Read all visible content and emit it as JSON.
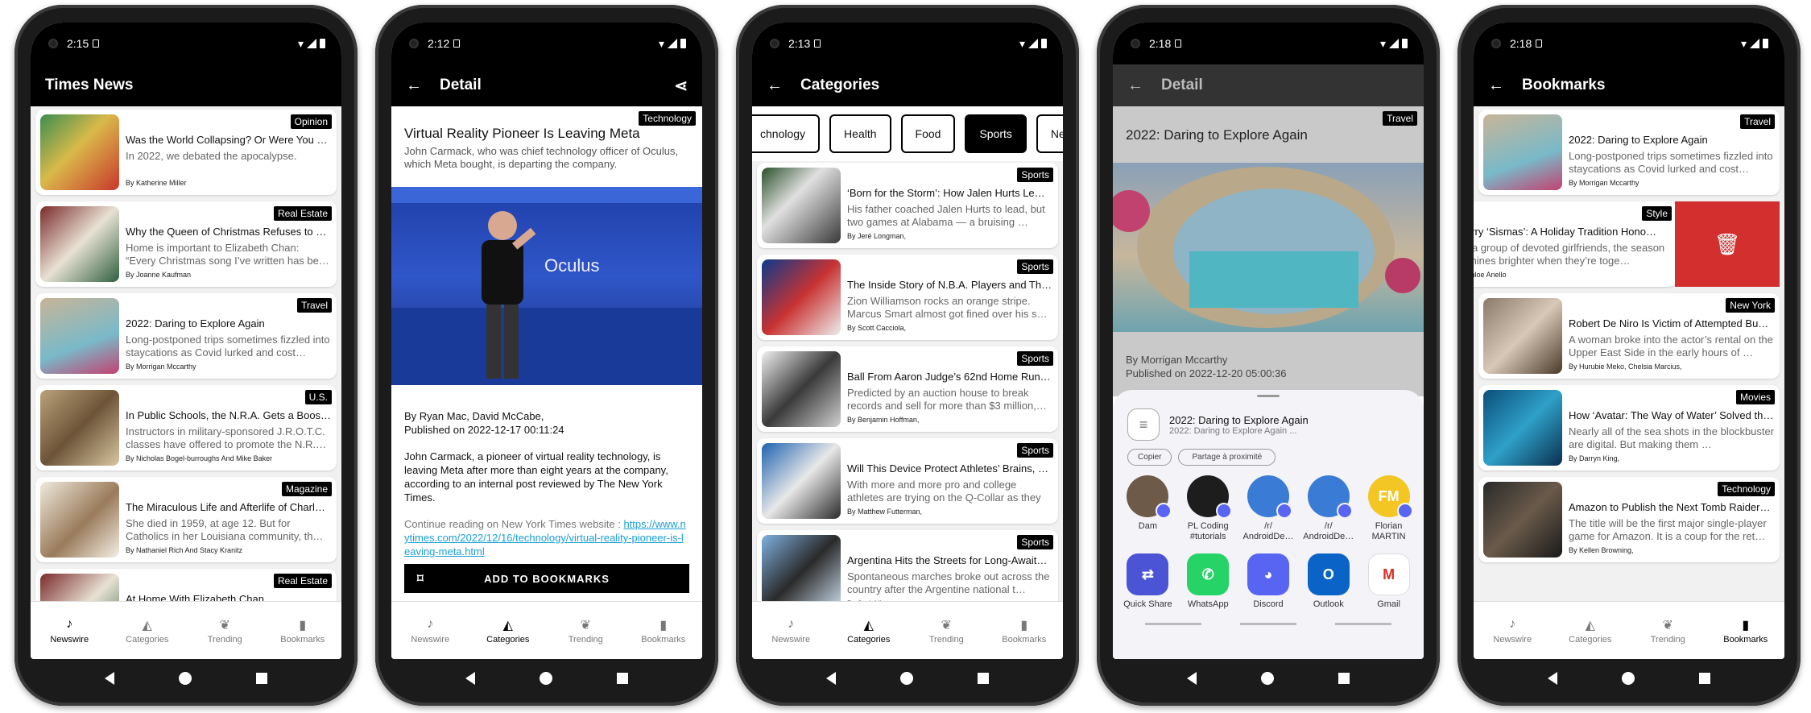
{
  "status_times": [
    "2:15",
    "2:12",
    "2:13",
    "2:18",
    "2:18"
  ],
  "nav": [
    "Newswire",
    "Categories",
    "Trending",
    "Bookmarks"
  ],
  "icons": {
    "newswire": "bell-icon",
    "categories": "shapes-icon",
    "trending": "flame-icon",
    "bookmarks": "bookmark-icon",
    "back": "arrow-left-icon",
    "share": "share-icon",
    "delete": "trash-icon"
  },
  "colors": {
    "bar": "#000000",
    "link": "#1a9fd6",
    "delete_red": "#d32f2f",
    "list_bg": "#f1f1f1"
  },
  "s1": {
    "title": "Times News",
    "cards": [
      {
        "badge": "Opinion",
        "title": "Was the World Collapsing? Or Were You …",
        "sub": "In 2022, we debated the apocalypse.",
        "by": "By Katherine Miller"
      },
      {
        "badge": "Real Estate",
        "title": "Why the Queen of Christmas Refuses to …",
        "sub": "Home is important to Elizabeth Chan: “Every Christmas song I’ve written has be…",
        "by": "By Joanne Kaufman"
      },
      {
        "badge": "Travel",
        "title": "2022: Daring to Explore Again",
        "sub": "Long-postponed trips sometimes fizzled into staycations as Covid lurked and cost…",
        "by": "By Morrigan Mccarthy"
      },
      {
        "badge": "U.S.",
        "title": "In Public Schools, the N.R.A. Gets a Boos…",
        "sub": "Instructors in military-sponsored J.R.O.T.C. classes have offered to promote the N.R.…",
        "by": "By Nicholas Bogel-burroughs And Mike Baker"
      },
      {
        "badge": "Magazine",
        "title": "The Miraculous Life and Afterlife of Charl…",
        "sub": "She died in 1959, at age 12. But for Catholics in her Louisiana community, th…",
        "by": "By Nathaniel Rich And Stacy Kranitz"
      },
      {
        "badge": "Real Estate",
        "title": "At Home With Elizabeth Chan",
        "sub": "",
        "by": ""
      }
    ]
  },
  "s2": {
    "title": "Detail",
    "badge": "Technology",
    "headline": "Virtual Reality Pioneer Is Leaving Meta",
    "summary": "John Carmack, who was chief technology officer of Oculus, which Meta bought, is departing the company.",
    "byline": "By Ryan Mac, David McCabe,",
    "published": "Published on 2022-12-17 00:11:24",
    "body": "John Carmack, a pioneer of virtual reality technology, is leaving Meta after more than eight years at the company, according to an internal post reviewed by The New York Times.",
    "continue": "Continue reading on New York Times website : ",
    "link": "https://www.nytimes.com/2022/12/16/technology/virtual-reality-pioneer-is-leaving-meta.html",
    "button": "ADD TO BOOKMARKS",
    "stage_text": "Oculus"
  },
  "s3": {
    "title": "Categories",
    "chips": [
      "chnology",
      "Health",
      "Food",
      "Sports",
      "New"
    ],
    "cards": [
      {
        "badge": "Sports",
        "title": "‘Born for the Storm’: How Jalen Hurts Le…",
        "sub": "His father coached Jalen Hurts to lead, but two games at Alabama — a bruising …",
        "by": "By Jeré Longman,"
      },
      {
        "badge": "Sports",
        "title": "The Inside Story of N.B.A. Players and Th…",
        "sub": "Zion Williamson rocks an orange stripe. Marcus Smart almost got fined over his s…",
        "by": "By Scott Cacciola,"
      },
      {
        "badge": "Sports",
        "title": "Ball From Aaron Judge’s 62nd Home Run…",
        "sub": "Predicted by an auction house to break records and sell for more than $3 million,…",
        "by": "By Benjamin Hoffman,"
      },
      {
        "badge": "Sports",
        "title": "Will This Device Protect Athletes’ Brains, …",
        "sub": "With more and more pro and college athletes are trying on the Q-Collar as they search f…",
        "by": "By Matthew Futterman,"
      },
      {
        "badge": "Sports",
        "title": "Argentina Hits the Streets for Long-Await…",
        "sub": "Spontaneous marches broke out across the country after the Argentine national t…",
        "by": "By Jack Nicas,"
      }
    ]
  },
  "s4": {
    "title": "Detail",
    "badge": "Travel",
    "headline": "2022: Daring to Explore Again",
    "byline": "By Morrigan Mccarthy",
    "published": "Published on 2022-12-20 05:00:36",
    "share_title": "2022: Daring to Explore Again",
    "share_sub": "2022: Daring to Explore Again ...",
    "copy": "Copier",
    "nearby": "Partage à proximité",
    "people": [
      {
        "name": "Dam",
        "color": "#6d5a48"
      },
      {
        "name": "PL Coding #tutorials",
        "color": "#1d1d1d"
      },
      {
        "name": "/r/ AndroidDe…",
        "color": "#3a7bd5"
      },
      {
        "name": "/r/ AndroidDe…",
        "color": "#3a7bd5"
      },
      {
        "name": "Florian MARTIN",
        "color": "#f3c623",
        "initials": "FM"
      }
    ],
    "apps": [
      {
        "name": "Quick Share",
        "color": "#4a54d4",
        "glyph": "⇄"
      },
      {
        "name": "WhatsApp",
        "color": "#25d366",
        "glyph": "✆"
      },
      {
        "name": "Discord",
        "color": "#5865f2",
        "glyph": "◕"
      },
      {
        "name": "Outlook",
        "color": "#0a64c8",
        "glyph": "O"
      },
      {
        "name": "Gmail",
        "color": "#ffffff",
        "glyph": "M"
      }
    ]
  },
  "s5": {
    "title": "Bookmarks",
    "cards": [
      {
        "badge": "Travel",
        "title": "2022: Daring to Explore Again",
        "sub": "Long-postponed trips sometimes fizzled into staycations as Covid lurked and cost…",
        "by": "By Morrigan Mccarthy"
      },
      {
        "badge": "Style",
        "title": "erry ‘Sismas’: A Holiday Tradition Hono…",
        "sub": "r a group of devoted girlfriends, the season shines brighter when they’re toge…",
        "by": "Chloe Anello"
      },
      {
        "badge": "New York",
        "title": "Robert De Niro Is Victim of Attempted Bu…",
        "sub": "A woman broke into the actor’s rental on the Upper East Side in the early hours of …",
        "by": "By Hurubie Meko, Chelsia Marcius,"
      },
      {
        "badge": "Movies",
        "title": "How ‘Avatar: The Way of Water’ Solved th…",
        "sub": "Nearly all of the sea shots in the blockbuster are digital. But making them …",
        "by": "By Darryn King,"
      },
      {
        "badge": "Technology",
        "title": "Amazon to Publish the Next Tomb Raider…",
        "sub": "The title will be the first major single-player game for Amazon. It is a coup for the ret…",
        "by": "By Kellen Browning,"
      }
    ]
  }
}
